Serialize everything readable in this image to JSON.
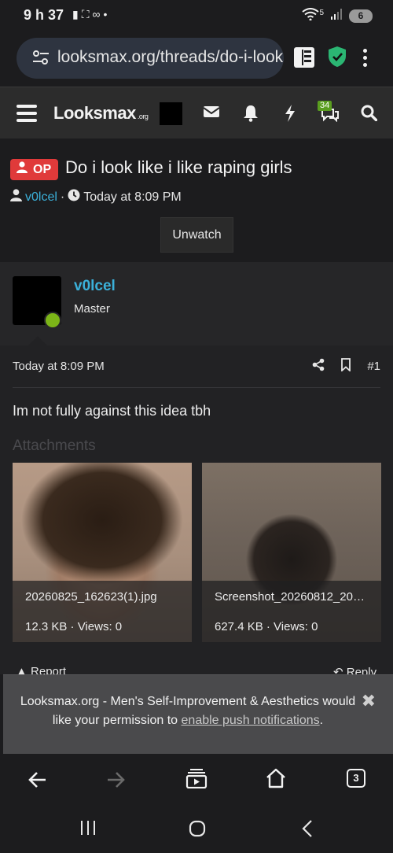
{
  "status_bar": {
    "time": "9 h 37",
    "signal_label": "5",
    "battery": "6",
    "icons": [
      "alert-icon",
      "screenshot-icon",
      "voicemail-icon",
      "dot-icon",
      "wifi-icon",
      "cellular-signal-icon"
    ]
  },
  "browser": {
    "url": "looksmax.org/threads/do-i-looks-like-i-like-raping-girls",
    "tab_count": "3"
  },
  "site_header": {
    "logo_text": "Looksmax",
    "logo_suffix": ".org",
    "alerts_badge": "34"
  },
  "thread": {
    "op_badge": "OP",
    "title": "Do i look like i like raping girls",
    "author": "v0lcel",
    "separator": "·",
    "time": "Today at 8:09 PM",
    "unwatch_label": "Unwatch"
  },
  "post": {
    "username": "v0lcel",
    "rank": "Master",
    "date": "Today at 8:09 PM",
    "post_number": "#1",
    "body": "Im not fully against this idea tbh",
    "attachments_heading": "Attachments",
    "attachments": [
      {
        "filename": "20260825_162623(1).jpg",
        "meta": "12.3 KB · Views: 0"
      },
      {
        "filename": "Screenshot_20260812_20…",
        "meta": "627.4 KB · Views: 0"
      }
    ],
    "report_label": "Report",
    "reply_label": "Reply"
  },
  "notification": {
    "text_before": "Looksmax.org - Men's Self-Improvement & Aesthetics would like your permission to ",
    "link_text": "enable push notifications",
    "text_after": "."
  },
  "colors": {
    "accent_blue": "#3bb0d9",
    "op_red": "#e03a3a",
    "online_green": "#7cb518"
  }
}
